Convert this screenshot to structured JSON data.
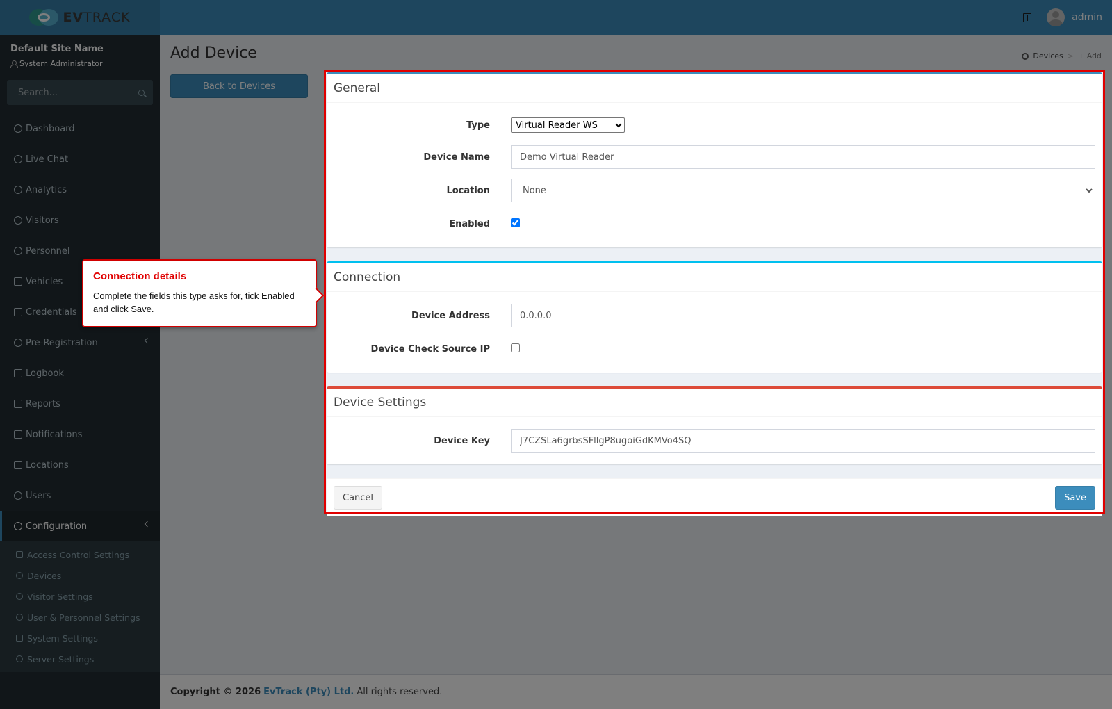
{
  "header": {
    "logo_text_bold": "EV",
    "logo_text_rest": "TRACK",
    "user_name": "admin"
  },
  "sidebar": {
    "site_name": "Default Site Name",
    "user_role": "System Administrator",
    "search_placeholder": "Search...",
    "items": [
      {
        "label": "Dashboard",
        "icon": "dashboard-icon"
      },
      {
        "label": "Live Chat",
        "icon": "headset-icon"
      },
      {
        "label": "Analytics",
        "icon": "target-icon"
      },
      {
        "label": "Visitors",
        "icon": "eye-icon"
      },
      {
        "label": "Personnel",
        "icon": "user-check-icon"
      },
      {
        "label": "Vehicles",
        "icon": "car-icon"
      },
      {
        "label": "Credentials",
        "icon": "id-card-icon"
      },
      {
        "label": "Pre-Registration",
        "icon": "arrows-icon"
      },
      {
        "label": "Logbook",
        "icon": "book-icon"
      },
      {
        "label": "Reports",
        "icon": "chart-icon"
      },
      {
        "label": "Notifications",
        "icon": "chat-icon"
      },
      {
        "label": "Locations",
        "icon": "building-icon"
      },
      {
        "label": "Users",
        "icon": "users-icon"
      },
      {
        "label": "Configuration",
        "icon": "gear-icon"
      }
    ],
    "config_subitems": [
      {
        "label": "Access Control Settings",
        "icon": "lock-icon"
      },
      {
        "label": "Devices",
        "icon": "gear-icon"
      },
      {
        "label": "Visitor Settings",
        "icon": "eye-icon"
      },
      {
        "label": "User & Personnel Settings",
        "icon": "users-icon"
      },
      {
        "label": "System Settings",
        "icon": "sliders-icon"
      },
      {
        "label": "Server Settings",
        "icon": "server-icon"
      }
    ]
  },
  "page": {
    "title": "Add Device",
    "back_button": "Back to Devices",
    "breadcrumb": {
      "parent": "Devices",
      "separator": ">",
      "current": "+ Add"
    }
  },
  "general": {
    "title": "General",
    "type_label": "Type",
    "type_value": "Virtual Reader WS",
    "device_name_label": "Device Name",
    "device_name_value": "Demo Virtual Reader",
    "location_label": "Location",
    "location_value": "None",
    "enabled_label": "Enabled",
    "enabled_checked": true
  },
  "connection": {
    "title": "Connection",
    "address_label": "Device Address",
    "address_value": "0.0.0.0",
    "check_ip_label": "Device Check Source IP",
    "check_ip_checked": false
  },
  "device_settings": {
    "title": "Device Settings",
    "key_label": "Device Key",
    "key_value": "J7CZSLa6grbsSFllgP8ugoiGdKMVo4SQ"
  },
  "actions": {
    "cancel": "Cancel",
    "save": "Save"
  },
  "tooltip": {
    "title": "Connection details",
    "text": "Complete the fields this type asks for, tick Enabled and click Save."
  },
  "footer": {
    "copyright": "Copyright © 2026",
    "company": "EvTrack (Pty) Ltd.",
    "rights": "All rights reserved."
  },
  "colors": {
    "header": "#3c8dbc",
    "sidebar": "#222d32",
    "highlight": "#e00000"
  }
}
